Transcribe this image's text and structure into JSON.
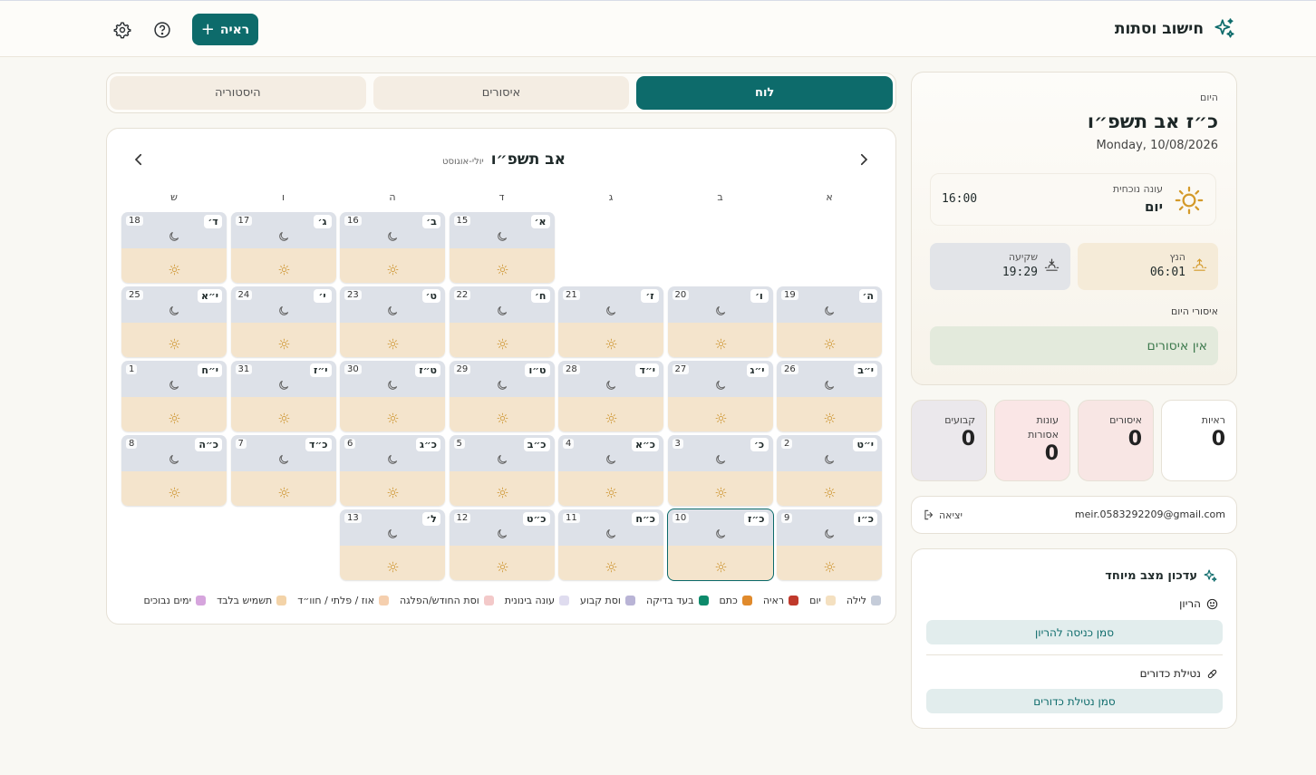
{
  "app": {
    "title": "חישוב וסתות",
    "add_label": "ראיה"
  },
  "tabs": [
    {
      "label": "לוח",
      "active": true
    },
    {
      "label": "איסורים",
      "active": false
    },
    {
      "label": "היסטוריה",
      "active": false
    }
  ],
  "calendar": {
    "title": "אב תשפ״ו",
    "subtitle": "יולי-אוגוסט",
    "weekdays": [
      "א",
      "ב",
      "ג",
      "ד",
      "ה",
      "ו",
      "ש"
    ],
    "offset": 3,
    "days": [
      {
        "heb": "א׳",
        "greg": "15"
      },
      {
        "heb": "ב׳",
        "greg": "16"
      },
      {
        "heb": "ג׳",
        "greg": "17"
      },
      {
        "heb": "ד׳",
        "greg": "18"
      },
      {
        "heb": "ה׳",
        "greg": "19"
      },
      {
        "heb": "ו׳",
        "greg": "20"
      },
      {
        "heb": "ז׳",
        "greg": "21"
      },
      {
        "heb": "ח׳",
        "greg": "22"
      },
      {
        "heb": "ט׳",
        "greg": "23"
      },
      {
        "heb": "י׳",
        "greg": "24"
      },
      {
        "heb": "י״א",
        "greg": "25"
      },
      {
        "heb": "י״ב",
        "greg": "26"
      },
      {
        "heb": "י״ג",
        "greg": "27"
      },
      {
        "heb": "י״ד",
        "greg": "28"
      },
      {
        "heb": "ט״ו",
        "greg": "29"
      },
      {
        "heb": "ט״ז",
        "greg": "30"
      },
      {
        "heb": "י״ז",
        "greg": "31"
      },
      {
        "heb": "י״ח",
        "greg": "1"
      },
      {
        "heb": "י״ט",
        "greg": "2"
      },
      {
        "heb": "כ׳",
        "greg": "3"
      },
      {
        "heb": "כ״א",
        "greg": "4"
      },
      {
        "heb": "כ״ב",
        "greg": "5"
      },
      {
        "heb": "כ״ג",
        "greg": "6"
      },
      {
        "heb": "כ״ד",
        "greg": "7"
      },
      {
        "heb": "כ״ה",
        "greg": "8"
      },
      {
        "heb": "כ״ו",
        "greg": "9"
      },
      {
        "heb": "כ״ז",
        "greg": "10",
        "today": true
      },
      {
        "heb": "כ״ח",
        "greg": "11"
      },
      {
        "heb": "כ״ט",
        "greg": "12"
      },
      {
        "heb": "ל׳",
        "greg": "13"
      }
    ]
  },
  "legend": [
    {
      "label": "לילה",
      "color": "#c5ccd9"
    },
    {
      "label": "יום",
      "color": "#f4e0c0"
    },
    {
      "label": "ראיה",
      "color": "#c0392b"
    },
    {
      "label": "כתם",
      "color": "#e08a2c"
    },
    {
      "label": "בעד בדיקה",
      "color": "#0d8a6b"
    },
    {
      "label": "וסת קבוע",
      "color": "#b9b4d6"
    },
    {
      "label": "עונה בינונית",
      "color": "#dfdcef"
    },
    {
      "label": "וסת החודש/הפלגה",
      "color": "#f3c9c9"
    },
    {
      "label": "אוז / פלתי / חוו״ד",
      "color": "#f5cfae"
    },
    {
      "label": "תשמיש בלבד",
      "color": "#f3d3a8"
    },
    {
      "label": "ימים נבוכים",
      "color": "#d6a5dd"
    }
  ],
  "today": {
    "label": "היום",
    "hebrew_date": "כ״ז אב תשפ״ו",
    "greg_date": "Monday, 10/08/2026",
    "onah_label": "עונה נוכחית",
    "onah_value": "יום",
    "onah_time": "16:00",
    "sunrise_label": "הנץ",
    "sunrise_time": "06:01",
    "sunset_label": "שקיעה",
    "sunset_time": "19:29",
    "issurim_label": "איסורי היום",
    "no_issurim": "אין איסורים"
  },
  "stats": [
    {
      "label": "ראיות",
      "value": "0"
    },
    {
      "label": "איסורים",
      "value": "0"
    },
    {
      "label": "עונות אסורות",
      "value": "0"
    },
    {
      "label": "קבועים",
      "value": "0"
    }
  ],
  "user": {
    "email": "meir.0583292209@gmail.com",
    "logout": "יציאה"
  },
  "special": {
    "title": "עדכון מצב מיוחד",
    "pregnancy_label": "הריון",
    "pregnancy_button": "סמן כניסה להריון",
    "pills_label": "נטילת כדורים",
    "pills_button": "סמן נטילת כדורים"
  }
}
